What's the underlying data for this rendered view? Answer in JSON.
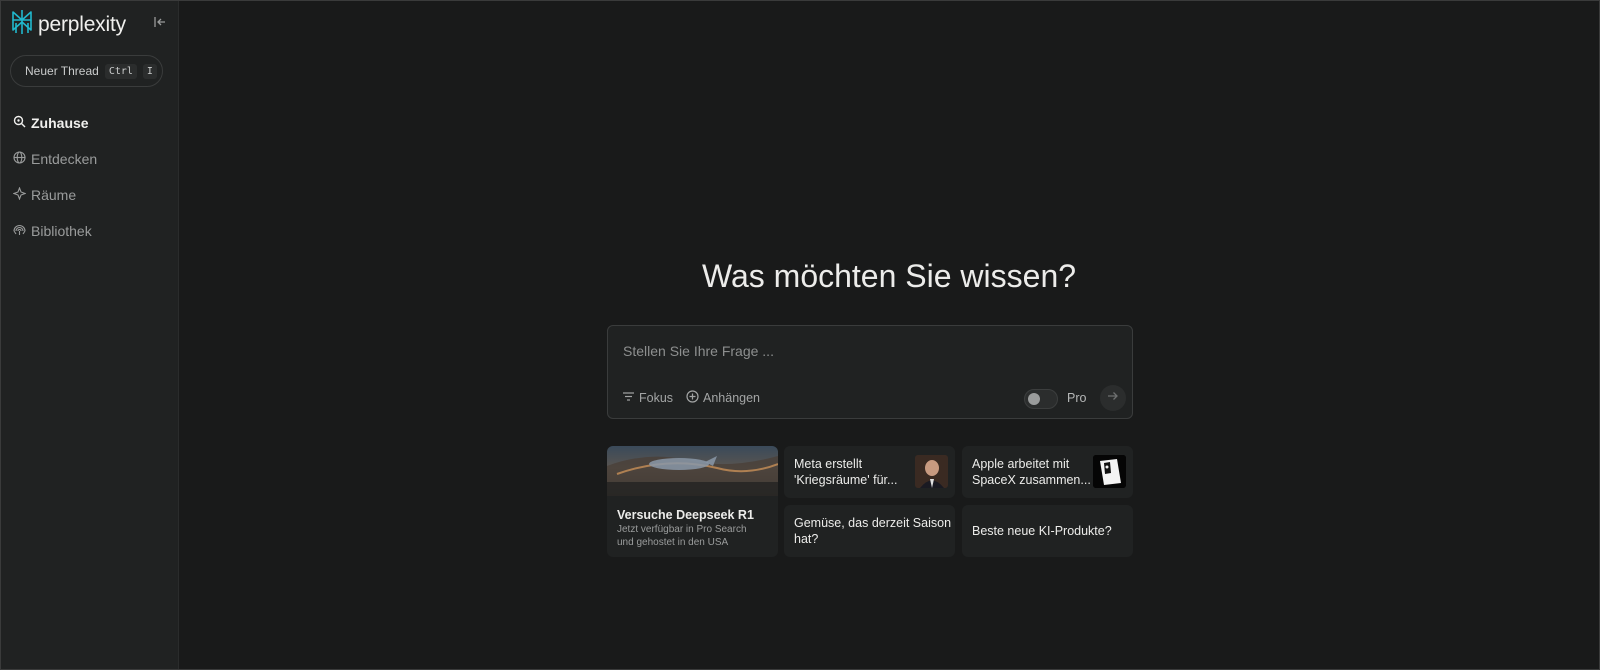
{
  "app": {
    "name": "perplexity"
  },
  "sidebar": {
    "new_thread": {
      "label": "Neuer Thread",
      "key1": "Ctrl",
      "key2": "I"
    },
    "items": [
      {
        "label": "Zuhause",
        "icon": "search-icon",
        "active": true
      },
      {
        "label": "Entdecken",
        "icon": "globe-icon",
        "active": false
      },
      {
        "label": "Räume",
        "icon": "sparkle-icon",
        "active": false
      },
      {
        "label": "Bibliothek",
        "icon": "library-icon",
        "active": false
      }
    ]
  },
  "main": {
    "headline": "Was möchten Sie wissen?",
    "search": {
      "placeholder": "Stellen Sie Ihre Frage ...",
      "focus_label": "Fokus",
      "attach_label": "Anhängen",
      "pro_label": "Pro",
      "pro_enabled": false
    },
    "cards": {
      "featured": {
        "title": "Versuche Deepseek R1",
        "subtitle_line1": "Jetzt verfügbar in Pro Search",
        "subtitle_line2": "und gehostet in den USA"
      },
      "c1": {
        "line1": "Meta erstellt",
        "line2": "'Kriegsräume' für..."
      },
      "c2": {
        "line1": "Apple arbeitet mit",
        "line2": "SpaceX zusammen..."
      },
      "c3": {
        "line1": "Gemüse, das derzeit Saison",
        "line2": "hat?"
      },
      "c4": {
        "line1": "Beste neue KI-Produkte?"
      }
    }
  },
  "colors": {
    "background": "#191a1a",
    "sidebar": "#202222",
    "accent": "#20808d"
  }
}
